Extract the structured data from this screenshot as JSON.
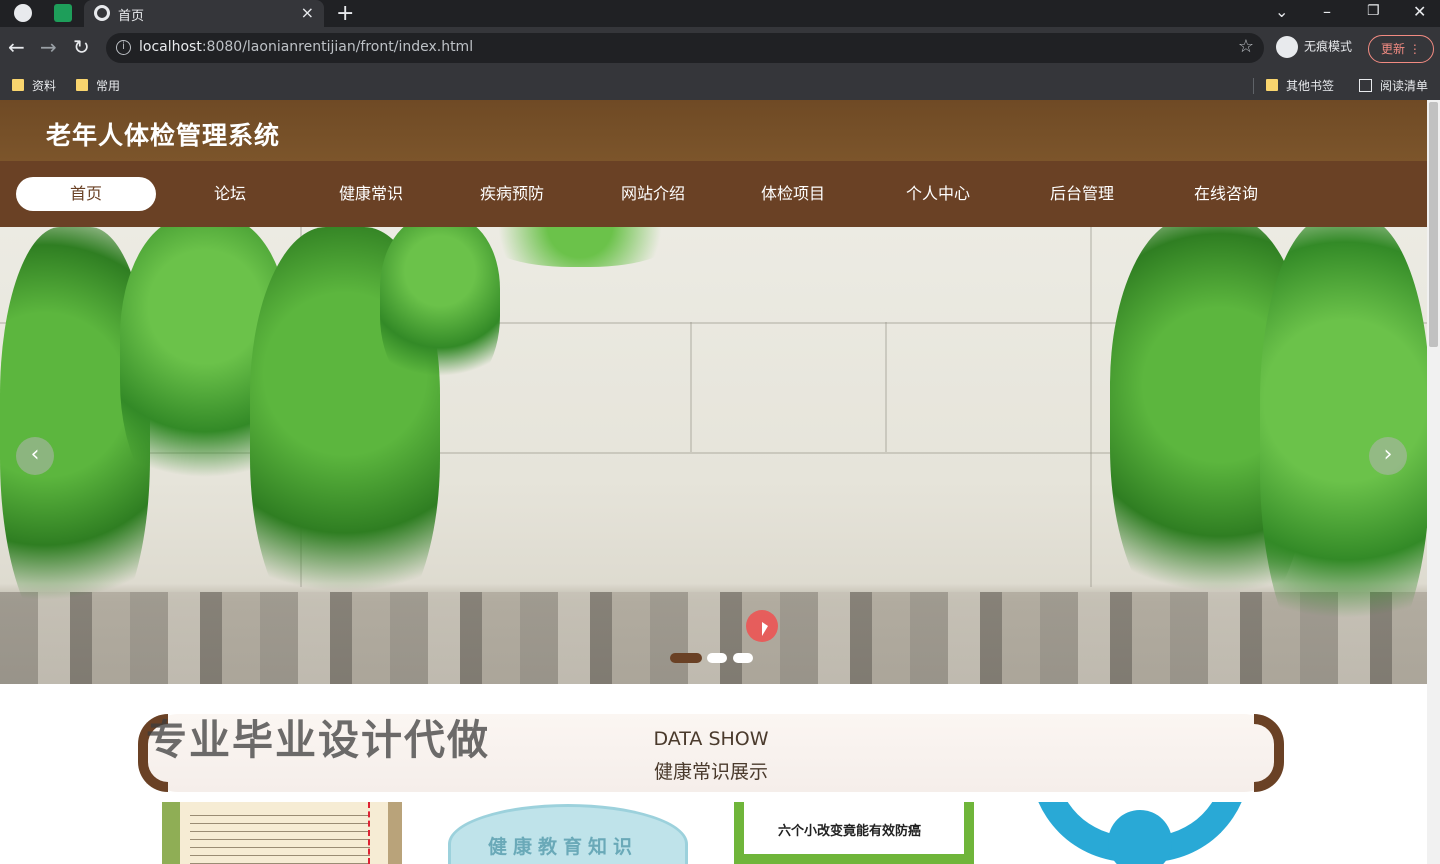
{
  "browser": {
    "tab_title": "首页",
    "tab_close": "×",
    "new_tab": "+",
    "url_host": "localhost",
    "url_path": ":8080/laonianrentijian/front/index.html",
    "incognito_label": "无痕模式",
    "update_label": "更新",
    "bookmarks": [
      "资料",
      "常用"
    ],
    "other_bookmarks": "其他书签",
    "reading_list": "阅读清单",
    "controls": {
      "back": "←",
      "forward": "→",
      "reload": "↻",
      "minimize": "–",
      "restore": "❐",
      "close": "✕",
      "tab_search": "⌄",
      "star": "☆",
      "more": "⋮"
    }
  },
  "site": {
    "title": "老年人体检管理系统",
    "nav": [
      "首页",
      "论坛",
      "健康常识",
      "疾病预防",
      "网站介绍",
      "体检项目",
      "个人中心",
      "后台管理",
      "在线咨询"
    ],
    "active_nav": 0,
    "carousel": {
      "prev": "‹",
      "next": "›",
      "slides": 3,
      "active": 0
    },
    "section": {
      "en": "DATA SHOW",
      "cn": "健康常识展示"
    },
    "watermark": "专业毕业设计代做",
    "cards": [
      {
        "text": ""
      },
      {
        "text": "健康教育知识"
      },
      {
        "text": "六个小改变竟能有效防癌"
      },
      {
        "text": ""
      }
    ]
  },
  "colors": {
    "brand": "#6a4125",
    "header": "#7c552b",
    "chrome": "#35363a"
  }
}
